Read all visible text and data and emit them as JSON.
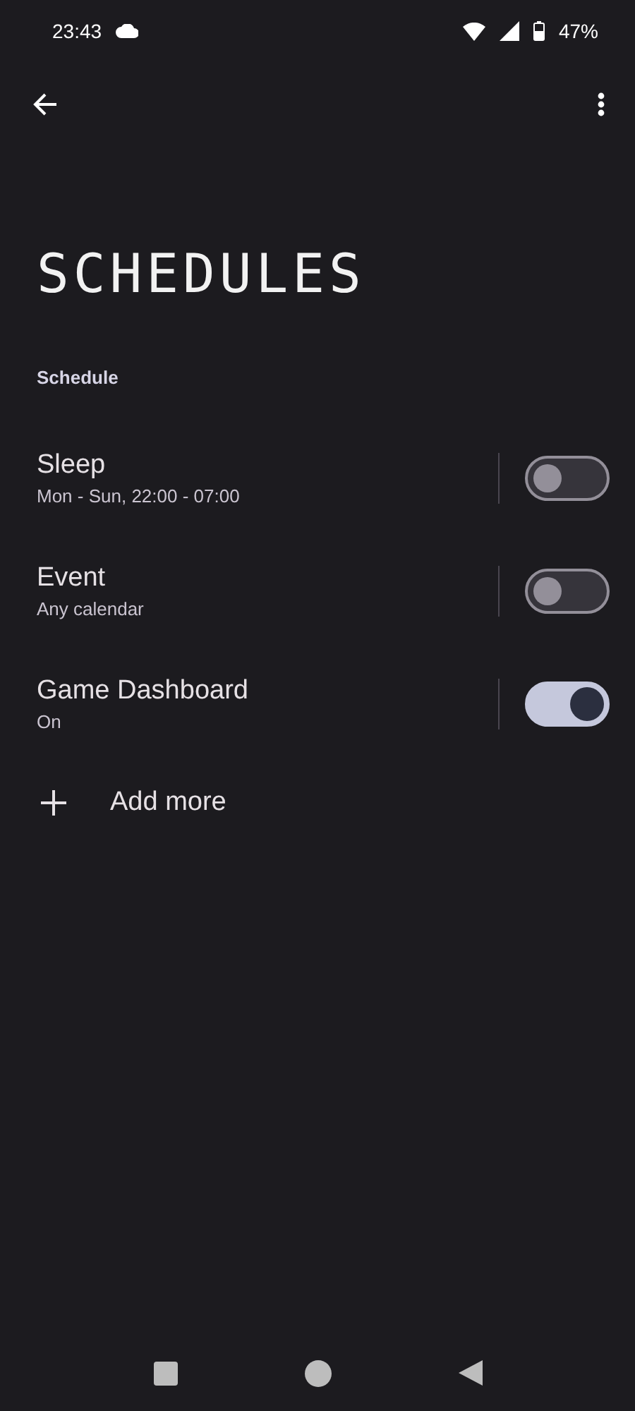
{
  "status_bar": {
    "time": "23:43",
    "battery": "47%"
  },
  "title": "SCHEDULES",
  "section": "Schedule",
  "schedules": [
    {
      "name": "Sleep",
      "detail": "Mon - Sun, 22:00 - 07:00",
      "on": false
    },
    {
      "name": "Event",
      "detail": "Any calendar",
      "on": false
    },
    {
      "name": "Game Dashboard",
      "detail": "On",
      "on": true
    }
  ],
  "add_button": {
    "label": "Add more"
  }
}
